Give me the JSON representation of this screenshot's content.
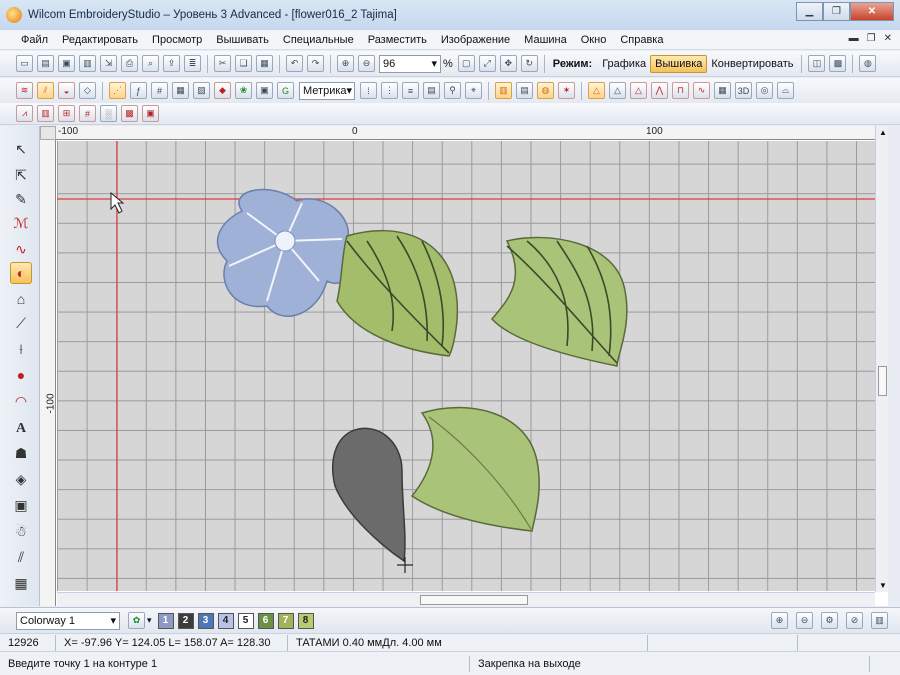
{
  "window": {
    "title": "Wilcom EmbroideryStudio – Уровень 3 Advanced - [flower016_2          Tajima]"
  },
  "menu": [
    "Файл",
    "Редактировать",
    "Просмотр",
    "Вышивать",
    "Специальные",
    "Разместить",
    "Изображение",
    "Машина",
    "Окно",
    "Справка"
  ],
  "toolbar": {
    "zoom_value": "96",
    "zoom_unit": "%",
    "mode_label": "Режим:",
    "mode_buttons": [
      "Графика",
      "Вышивка",
      "Конвертировать"
    ],
    "active_mode": "Вышивка",
    "units_value": "Метрика"
  },
  "rulers": {
    "top_labels": [
      "-100",
      "0",
      "100"
    ],
    "left_label": "-100"
  },
  "colorway": {
    "selected": "Colorway 1",
    "swatches": [
      {
        "num": "1",
        "color": "#8d9bc4"
      },
      {
        "num": "2",
        "color": "#3c3c3c"
      },
      {
        "num": "3",
        "color": "#4f77b8"
      },
      {
        "num": "4",
        "color": "#b8c2e8"
      },
      {
        "num": "5",
        "color": "#ffffff"
      },
      {
        "num": "6",
        "color": "#6d8f46"
      },
      {
        "num": "7",
        "color": "#a3b35a"
      },
      {
        "num": "8",
        "color": "#b6cc72"
      }
    ]
  },
  "status": {
    "stitch_count": "12926",
    "coords": "X=  -97.96 Y= 124.05 L= 158.07 A= 128.30",
    "stitch_info": "ТАТАМИ 0.40 ммДл. 4.00 мм",
    "prompt": "Введите точку 1 на контуре 1",
    "tie_off": "Закрепка на выходе"
  },
  "colors": {
    "canvas_bg": "#d6d6d6",
    "grid_line": "#9a9a9a",
    "guide_line": "#e23b3b",
    "active_button": "#f6c15a"
  }
}
